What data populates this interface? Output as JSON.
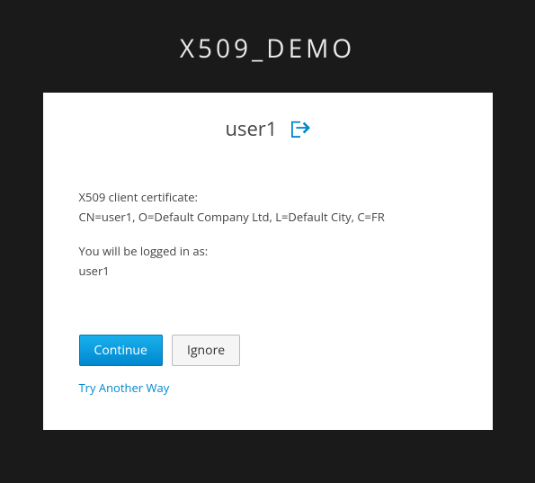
{
  "header": {
    "title": "X509_DEMO"
  },
  "card": {
    "username": "user1",
    "cert_label": "X509 client certificate:",
    "cert_dn": "CN=user1, O=Default Company Ltd, L=Default City, C=FR",
    "login_as_label": "You will be logged in as:",
    "login_as_value": "user1",
    "buttons": {
      "continue": "Continue",
      "ignore": "Ignore"
    },
    "try_another": "Try Another Way"
  }
}
